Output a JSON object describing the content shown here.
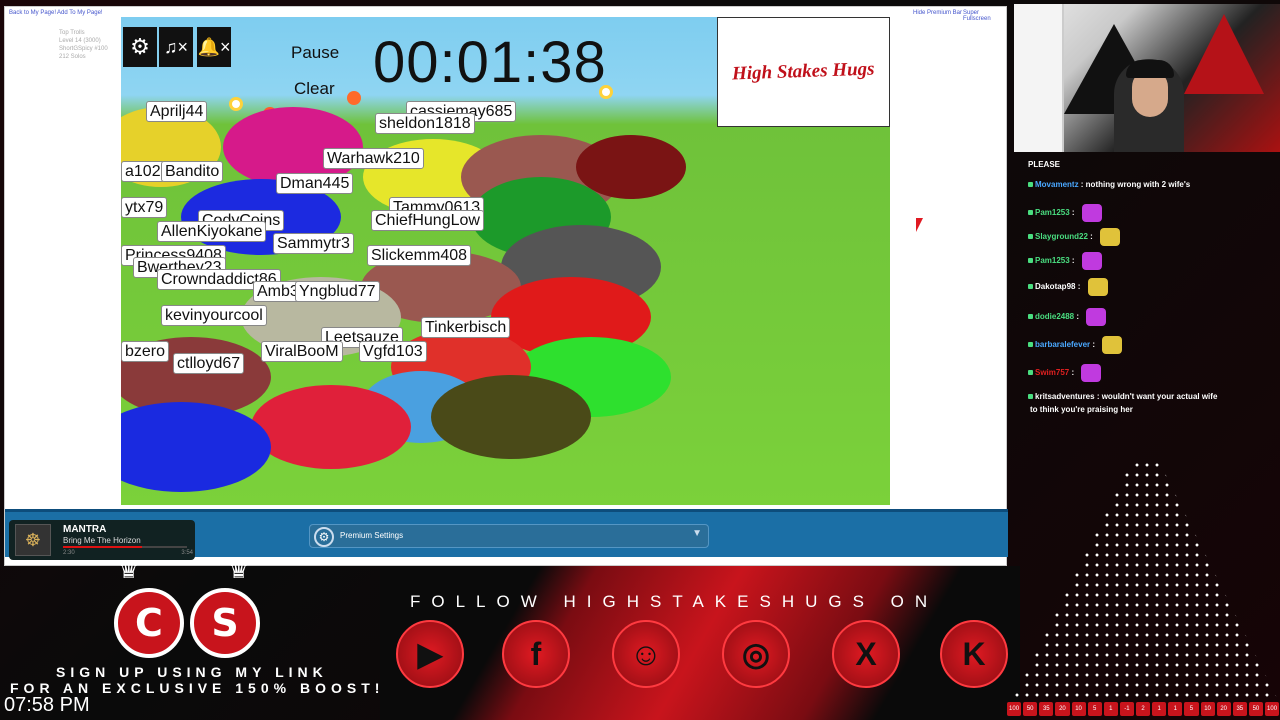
{
  "browser": {
    "link_back": "Back to My Page!",
    "link_add": "Add To My Page!",
    "link_hide": "Hide Premium Bar",
    "link_fullscreen": "Super Fullscreen",
    "leaderboard": [
      "Top Trolls",
      "Level 14 (3000)",
      "ShortGSpicy #100",
      "212 Solos"
    ]
  },
  "game": {
    "pause_label": "Pause",
    "clear_label": "Clear",
    "timer": "00:01:38",
    "logo_text": "High Stakes Hugs",
    "names": [
      "Aprilj44",
      "cassiemay685",
      "sheldon1818",
      "Warhawk210",
      "a102",
      "Bandito",
      "Dman445",
      "ytx79",
      "Tammy0613",
      "CodyCoins",
      "ChiefHungLow",
      "AllenKiyokane",
      "Sammytr3",
      "Princess9408",
      "Slickemm408",
      "Bwerthey23",
      "Crowndaddict86",
      "Amb3",
      "Yngblud77",
      "kevinyourcool",
      "Leetsauze",
      "Tinkerbisch",
      "bzero",
      "ctlloyd67",
      "ViralBooM",
      "Vgfd103"
    ]
  },
  "player": {
    "title": "MANTRA",
    "artist": "Bring Me The Horizon",
    "elapsed": "2:30",
    "total": "3:54",
    "progress_fraction": 0.64,
    "premium_label": "Premium Settings"
  },
  "chat": {
    "header": "PLEASE",
    "messages": [
      {
        "user": "Movamentz",
        "text": "nothing wrong with 2 wife's",
        "color": "#4aa8ff"
      },
      {
        "user": "Pam1253",
        "text": "",
        "color": "#4ade80"
      },
      {
        "user": "Slayground22",
        "text": "",
        "color": "#4ade80"
      },
      {
        "user": "Pam1253",
        "text": "",
        "color": "#4ade80"
      },
      {
        "user": "Dakotap98",
        "text": "",
        "color": "#ffffff"
      },
      {
        "user": "dodie2488",
        "text": "",
        "color": "#4ade80"
      },
      {
        "user": "barbaralefever",
        "text": "",
        "color": "#4aa8ff"
      },
      {
        "user": "Swim757",
        "text": "",
        "color": "#e02020"
      },
      {
        "user": "kritsadventures",
        "text": "wouldn't want your actual wife",
        "color": "#ffffff"
      }
    ],
    "continuation": "to think you're praising her"
  },
  "footer": {
    "signup_line1": "SIGN UP USING MY LINK",
    "signup_line2": "FOR AN EXCLUSIVE 150% BOOST!",
    "clock": "07:58 PM",
    "follow_text": "FOLLOW HIGHSTAKESHUGS ON",
    "socials": [
      "youtube-icon",
      "facebook-icon",
      "discord-icon",
      "instagram-icon",
      "x-icon",
      "kick-icon"
    ],
    "plinko_slots": [
      "100",
      "50",
      "35",
      "20",
      "10",
      "5",
      "1",
      "-1",
      "2",
      "1",
      "1",
      "5",
      "10",
      "20",
      "35",
      "50",
      "100"
    ]
  }
}
